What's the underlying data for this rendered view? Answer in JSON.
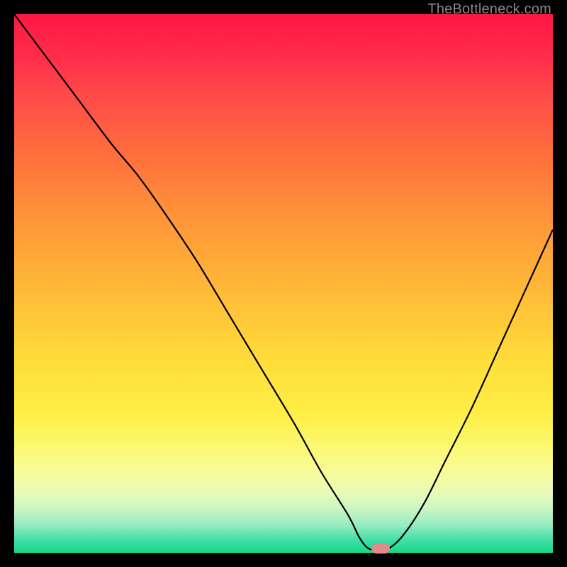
{
  "watermark": "TheBottleneck.com",
  "chart_data": {
    "type": "line",
    "title": "",
    "xlabel": "",
    "ylabel": "",
    "xlim": [
      0,
      100
    ],
    "ylim": [
      0,
      100
    ],
    "series": [
      {
        "name": "curve",
        "x": [
          0,
          6,
          12,
          18,
          23,
          28,
          34,
          40,
          46,
          52,
          57,
          62,
          64,
          65.5,
          67,
          69,
          72,
          76,
          80,
          85,
          90,
          95,
          100
        ],
        "y": [
          100,
          92,
          84,
          76,
          70,
          63,
          54,
          44,
          34,
          24,
          15,
          7,
          3,
          1,
          0.5,
          0.5,
          3,
          9,
          17,
          27,
          38,
          49,
          60
        ]
      }
    ],
    "marker": {
      "x": 68,
      "y": 0.8
    },
    "background_gradient": {
      "top": "#ff1744",
      "bottom": "#14d88a"
    }
  }
}
